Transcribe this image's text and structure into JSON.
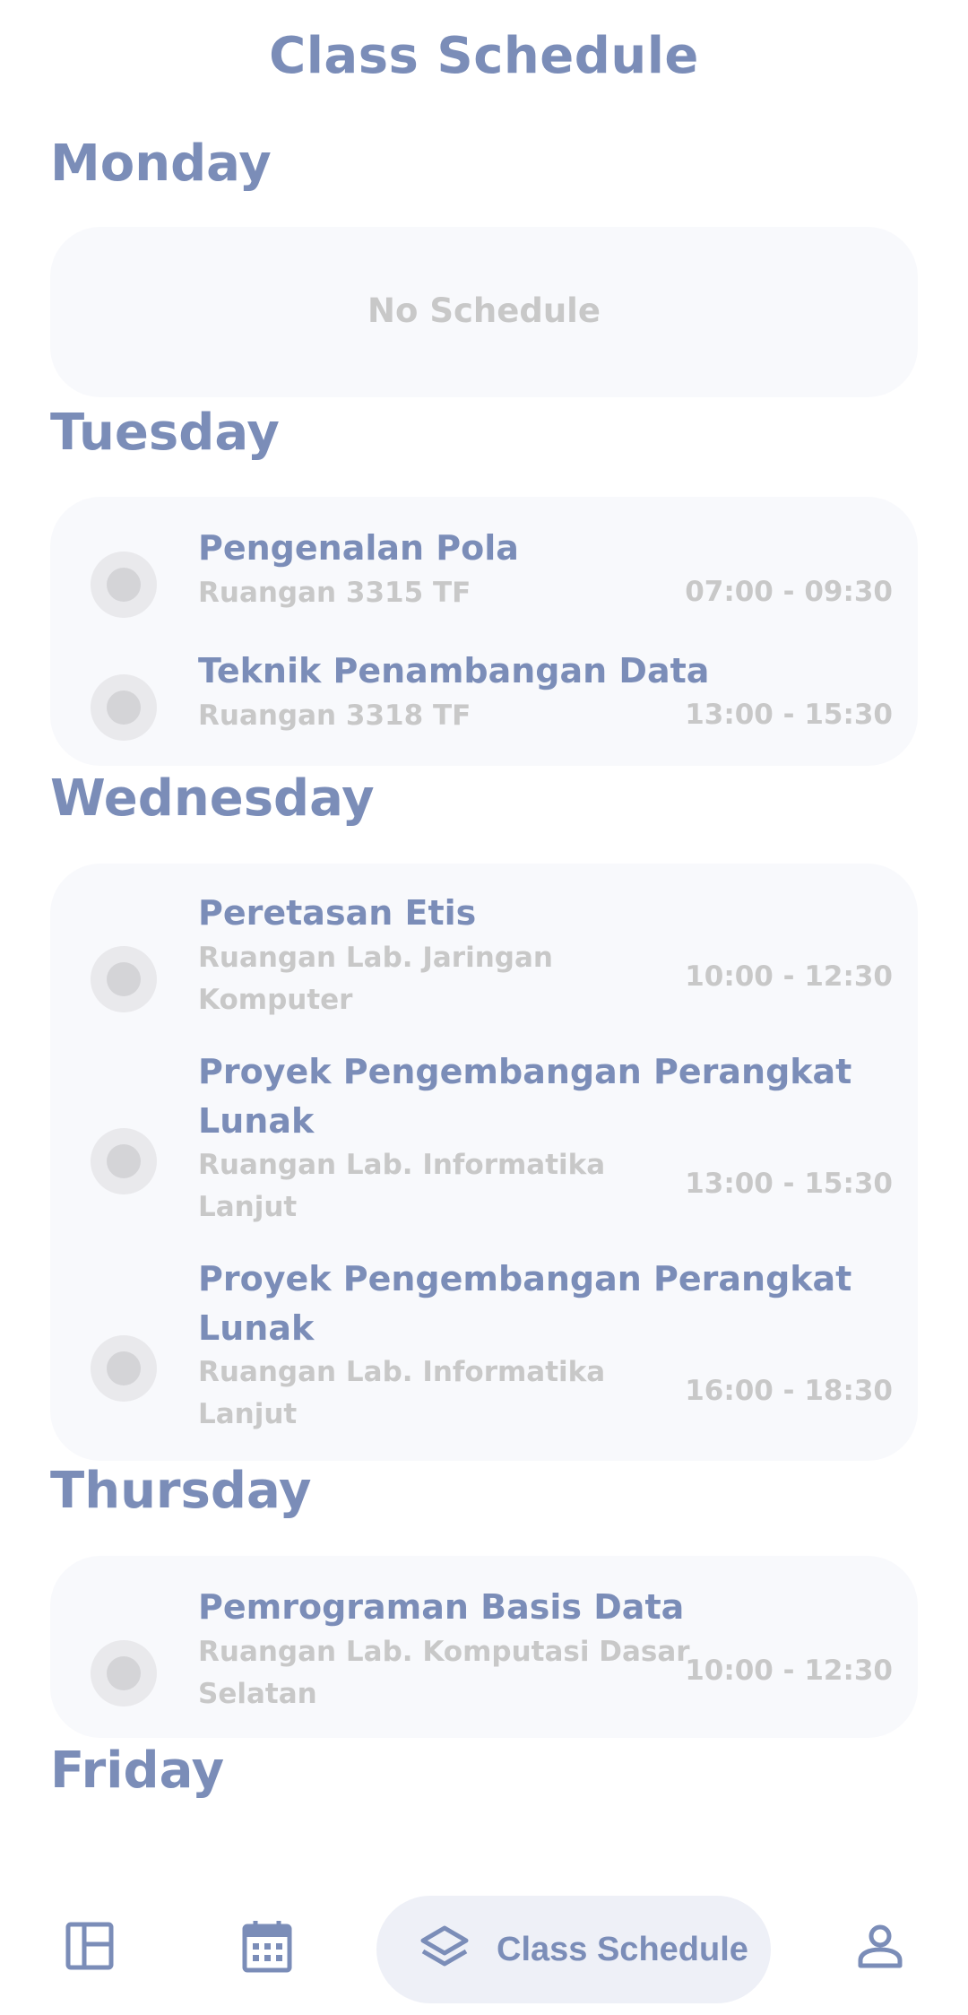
{
  "header": {
    "title": "Class Schedule"
  },
  "days": [
    {
      "name": "Monday",
      "empty_text": "No Schedule"
    },
    {
      "name": "Tuesday",
      "classes": [
        {
          "course": "Pengenalan Pola",
          "room": "Ruangan 3315 TF",
          "time": "07:00 - 09:30"
        },
        {
          "course": "Teknik Penambangan Data",
          "room": "Ruangan 3318 TF",
          "time": "13:00 - 15:30"
        }
      ]
    },
    {
      "name": "Wednesday",
      "classes": [
        {
          "course": "Peretasan Etis",
          "room": "Ruangan Lab. Jaringan Komputer",
          "time": "10:00 - 12:30"
        },
        {
          "course": "Proyek Pengembangan Perangkat Lunak",
          "room": "Ruangan Lab. Informatika Lanjut",
          "time": "13:00 - 15:30"
        },
        {
          "course": "Proyek Pengembangan Perangkat Lunak",
          "room": "Ruangan Lab. Informatika Lanjut",
          "time": "16:00 - 18:30"
        }
      ]
    },
    {
      "name": "Thursday",
      "classes": [
        {
          "course": "Pemrograman Basis Data",
          "room": "Ruangan Lab. Komputasi Dasar Selatan",
          "time": "10:00 - 12:30"
        }
      ]
    },
    {
      "name": "Friday"
    }
  ],
  "bottom_nav": {
    "items": [
      {
        "icon": "dashboard-icon"
      },
      {
        "icon": "calendar-icon"
      },
      {
        "icon": "layers-icon",
        "label": "Class Schedule",
        "active": true
      },
      {
        "icon": "profile-icon"
      }
    ]
  },
  "colors": {
    "accent": "#7b8db8",
    "muted": "#c8c8c8",
    "card": "#f8f9fc",
    "pill": "#eef0f7"
  }
}
